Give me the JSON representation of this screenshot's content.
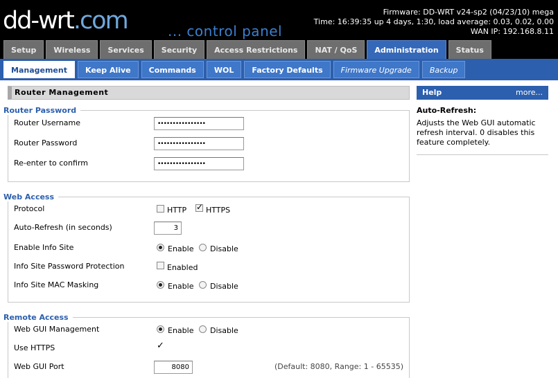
{
  "header": {
    "logo_text": "dd-wrt",
    "logo_suffix": ".com",
    "subtitle": "... control panel",
    "firmware": "Firmware: DD-WRT v24-sp2 (04/23/10) mega",
    "time": "Time: 16:39:35 up 4 days, 1:30, load average: 0.03, 0.02, 0.00",
    "wan_ip": "WAN IP: 192.168.8.11"
  },
  "main_tabs": [
    {
      "label": "Setup"
    },
    {
      "label": "Wireless"
    },
    {
      "label": "Services"
    },
    {
      "label": "Security"
    },
    {
      "label": "Access Restrictions"
    },
    {
      "label": "NAT / QoS"
    },
    {
      "label": "Administration"
    },
    {
      "label": "Status"
    }
  ],
  "active_main_tab": "Administration",
  "sub_tabs": [
    {
      "label": "Management"
    },
    {
      "label": "Keep Alive"
    },
    {
      "label": "Commands"
    },
    {
      "label": "WOL"
    },
    {
      "label": "Factory Defaults"
    },
    {
      "label": "Firmware Upgrade"
    },
    {
      "label": "Backup"
    }
  ],
  "active_sub_tab": "Management",
  "section_title": "Router Management",
  "router_password": {
    "legend": "Router Password",
    "username_label": "Router Username",
    "username_value": "••••••••••••••••",
    "password_label": "Router Password",
    "password_value": "••••••••••••••••",
    "confirm_label": "Re-enter to confirm",
    "confirm_value": "••••••••••••••••"
  },
  "web_access": {
    "legend": "Web Access",
    "protocol_label": "Protocol",
    "http_label": "HTTP",
    "http_checked": false,
    "https_label": "HTTPS",
    "https_checked": true,
    "refresh_label": "Auto-Refresh (in seconds)",
    "refresh_value": "3",
    "info_site_label": "Enable Info Site",
    "info_site_enable": "Enable",
    "info_site_disable": "Disable",
    "info_pw_label": "Info Site Password Protection",
    "info_pw_option": "Enabled",
    "info_pw_checked": false,
    "mac_mask_label": "Info Site MAC Masking",
    "mac_mask_enable": "Enable",
    "mac_mask_disable": "Disable"
  },
  "remote_access": {
    "legend": "Remote Access",
    "gui_mgmt_label": "Web GUI Management",
    "gui_mgmt_enable": "Enable",
    "gui_mgmt_disable": "Disable",
    "use_https_label": "Use HTTPS",
    "use_https_checked": true,
    "port_label": "Web GUI Port",
    "port_value": "8080",
    "port_hint": "(Default: 8080, Range: 1 - 65535)"
  },
  "help": {
    "title": "Help",
    "more": "more...",
    "topic": "Auto-Refresh:",
    "text": "Adjusts the Web GUI automatic refresh interval. 0 disables this feature completely."
  },
  "colors": {
    "active_tab": "#3568b8",
    "sub_bar": "#2c5fad",
    "legend": "#2c5fad"
  }
}
